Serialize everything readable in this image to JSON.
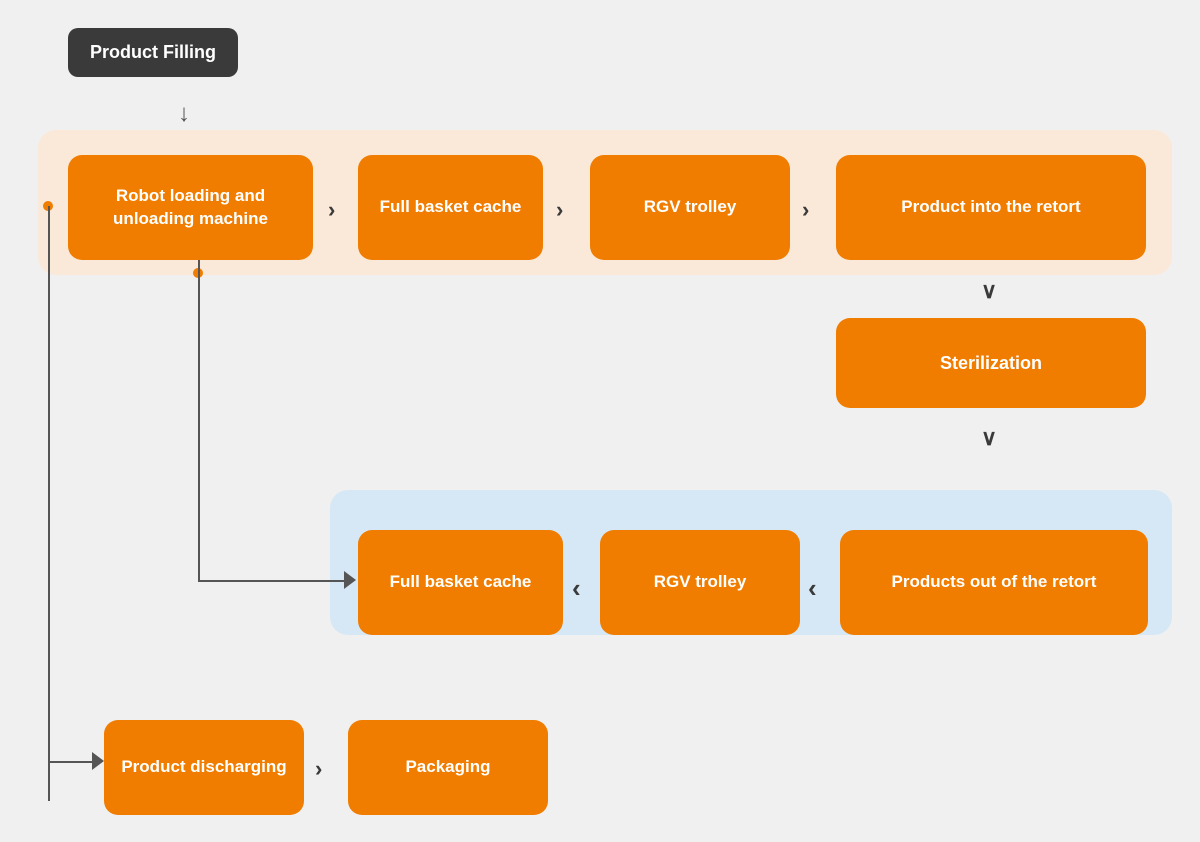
{
  "labels": {
    "product_filling": "Product Filling",
    "robot_loading": "Robot loading and unloading machine",
    "full_basket_cache_1": "Full basket cache",
    "rgv_trolley_1": "RGV trolley",
    "product_into_retort": "Product into the retort",
    "sterilization": "Sterilization",
    "full_basket_cache_2": "Full basket cache",
    "rgv_trolley_2": "RGV trolley",
    "products_out_retort": "Products out of the retort",
    "product_discharging": "Product discharging",
    "packaging": "Packaging"
  },
  "colors": {
    "orange": "#f07d00",
    "dark_bg": "#3a3a3a",
    "top_band": "#fae8d8",
    "bottom_band": "#d6e8f5",
    "bg": "#eeeeee",
    "arrow": "#555555"
  }
}
